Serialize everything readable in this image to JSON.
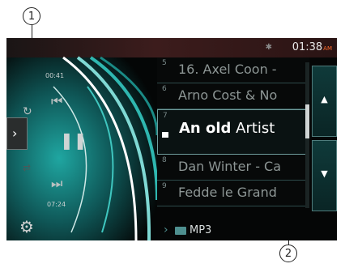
{
  "callouts": {
    "one": "1",
    "two": "2"
  },
  "status": {
    "time": "01:38",
    "ampm": "AM",
    "bluetooth_icon": "bluetooth-icon"
  },
  "player": {
    "elapsed": "00:41",
    "total": "07:24"
  },
  "list": {
    "rows": [
      {
        "num": "5",
        "title": "16. Axel Coon -"
      },
      {
        "num": "6",
        "title": "Arno Cost & No"
      },
      {
        "num": "7",
        "title_bold": "An old",
        "title_rest": " Artist"
      },
      {
        "num": "8",
        "title": "Dan Winter - Ca"
      },
      {
        "num": "9",
        "title": "Fedde le Grand"
      }
    ]
  },
  "footer": {
    "folder_label": "MP3"
  },
  "icons": {
    "repeat": "repeat-icon",
    "prev": "previous-track-icon",
    "pause": "pause-icon",
    "next": "next-track-icon",
    "shuffle": "shuffle-icon",
    "settings": "gear-icon",
    "side": "chevron-right-icon",
    "up": "up-arrow-icon",
    "down": "down-arrow-icon",
    "folder": "folder-icon",
    "play_indicator": "now-playing-icon"
  }
}
